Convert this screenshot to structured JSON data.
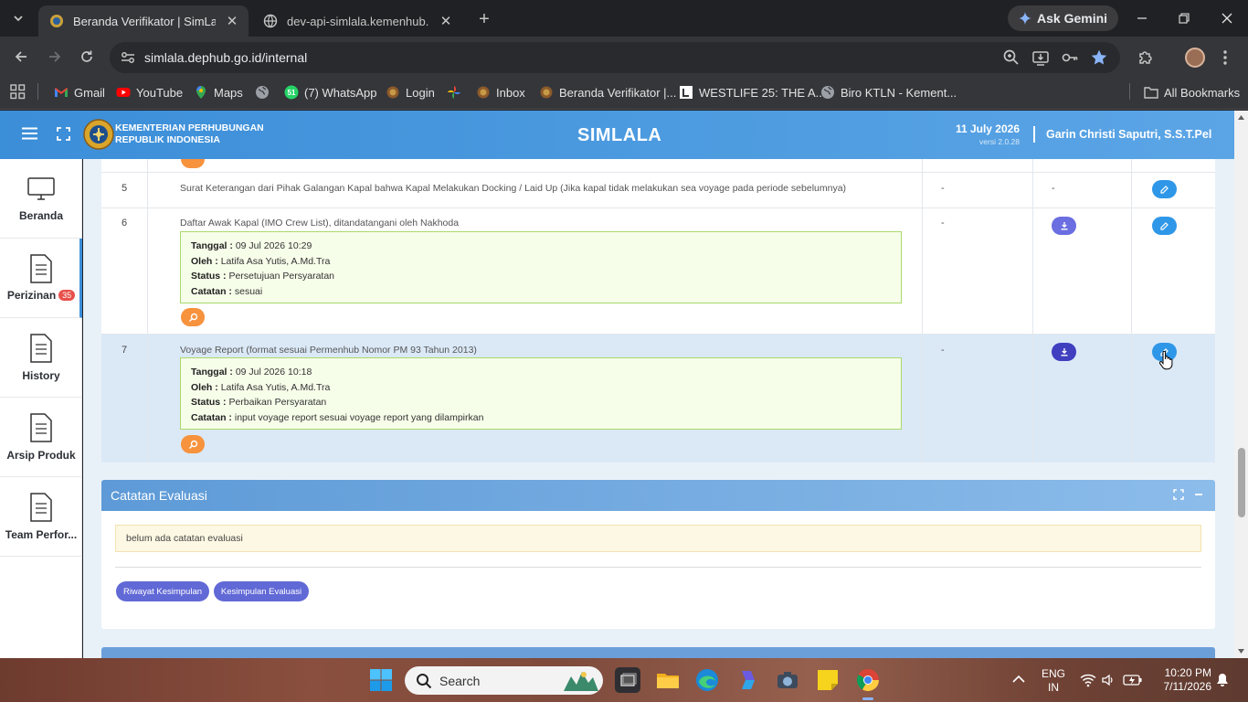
{
  "browser": {
    "tabs": [
      {
        "title": "Beranda Verifikator | SimLala",
        "active": true
      },
      {
        "title": "dev-api-simlala.kemenhub.go.id",
        "active": false
      }
    ],
    "ask_gemini": "Ask Gemini",
    "url": "simlala.dephub.go.id/internal",
    "bookmarks": [
      {
        "label": "Gmail",
        "icon": "gmail-icon"
      },
      {
        "label": "YouTube",
        "icon": "youtube-icon"
      },
      {
        "label": "Maps",
        "icon": "maps-icon"
      },
      {
        "label": "",
        "icon": "globe-icon"
      },
      {
        "label": "(7) WhatsApp",
        "icon": "whatsapp-icon",
        "badge": "51"
      },
      {
        "label": "Login",
        "icon": "site-icon"
      },
      {
        "label": "",
        "icon": "pinwheel-icon"
      },
      {
        "label": "Inbox",
        "icon": "inbox-icon"
      },
      {
        "label": "Beranda Verifikator |...",
        "icon": "site-icon"
      },
      {
        "label": "WESTLIFE 25: THE A...",
        "icon": "bookmark-l-icon"
      },
      {
        "label": "Biro KTLN - Kement...",
        "icon": "globe-icon"
      }
    ],
    "all_bookmarks": "All Bookmarks"
  },
  "header": {
    "ministry_line1": "KEMENTERIAN PERHUBUNGAN",
    "ministry_line2": "REPUBLIK INDONESIA",
    "app_title": "SIMLALA",
    "date": "11 July 2026",
    "version": "versi 2.0.28",
    "user": "Garin Christi Saputri, S.S.T.Pel"
  },
  "sidebar": {
    "items": [
      {
        "label": "Beranda",
        "icon": "monitor-icon"
      },
      {
        "label": "Perizinan",
        "icon": "document-icon",
        "badge": "35",
        "active": true
      },
      {
        "label": "History",
        "icon": "document-icon"
      },
      {
        "label": "Arsip Produk",
        "icon": "document-icon"
      },
      {
        "label": "Team Perfor...",
        "icon": "document-icon"
      }
    ]
  },
  "requirements": {
    "rows": [
      {
        "no": "5",
        "document": "Surat Keterangan dari Pihak Galangan Kapal bahwa Kapal Melakukan Docking / Laid Up (Jika kapal tidak melakukan sea voyage pada periode sebelumnya)",
        "col1": "-",
        "col2": "-"
      },
      {
        "no": "6",
        "document": "Daftar Awak Kapal (IMO Crew List), ditandatangani oleh Nakhoda",
        "col1": "-",
        "note": {
          "tanggal_label": "Tanggal :",
          "tanggal": "09 Jul 2026 10:29",
          "oleh_label": "Oleh :",
          "oleh": "Latifa Asa Yutis, A.Md.Tra",
          "status_label": "Status :",
          "status": "Persetujuan Persyaratan",
          "catatan_label": "Catatan :",
          "catatan": "sesuai"
        }
      },
      {
        "no": "7",
        "document": "Voyage Report (format sesuai Permenhub Nomor PM 93 Tahun 2013)",
        "col1": "-",
        "note": {
          "tanggal_label": "Tanggal :",
          "tanggal": "09 Jul 2026 10:18",
          "oleh_label": "Oleh :",
          "oleh": "Latifa Asa Yutis, A.Md.Tra",
          "status_label": "Status :",
          "status": "Perbaikan Persyaratan",
          "catatan_label": "Catatan :",
          "catatan": "input voyage report sesuai voyage report yang dilampirkan"
        }
      }
    ]
  },
  "evaluation": {
    "title": "Catatan Evaluasi",
    "empty_note": "belum ada catatan evaluasi",
    "btn_history": "Riwayat Kesimpulan",
    "btn_conclusion": "Kesimpulan Evaluasi"
  },
  "taskbar": {
    "search": "Search",
    "lang1": "ENG",
    "lang2": "IN",
    "time": "10:20 PM",
    "date": "7/11/2026"
  }
}
